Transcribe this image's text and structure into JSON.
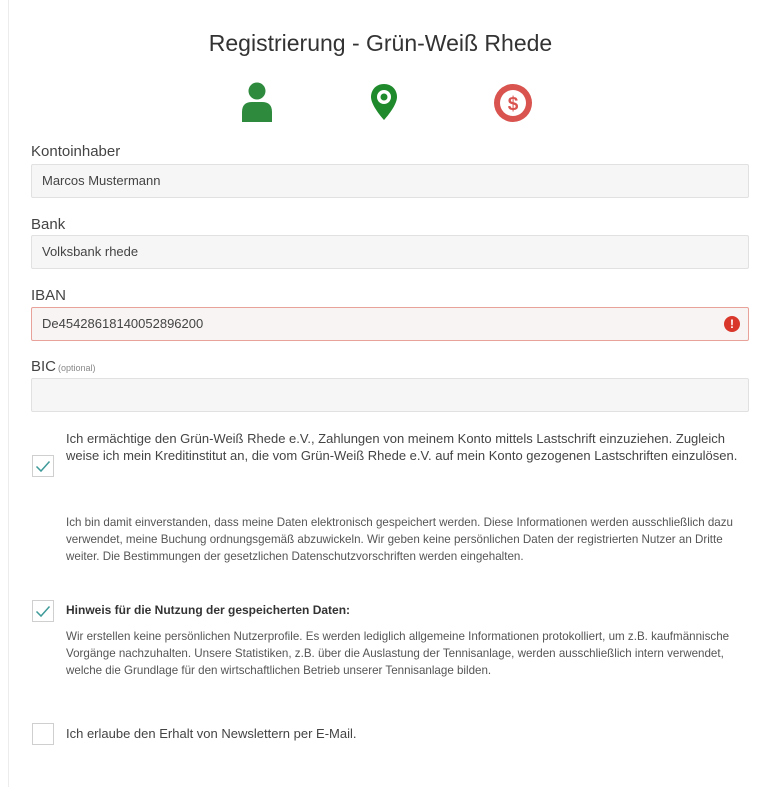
{
  "page": {
    "title": "Registrierung - Grün-Weiß Rhede"
  },
  "steps": [
    {
      "icon": "user-icon",
      "color": "#2e8b3e"
    },
    {
      "icon": "location-pin-icon",
      "color": "#1f8a2c"
    },
    {
      "icon": "dollar-circle-icon",
      "color": "#d9534f"
    }
  ],
  "fields": {
    "account_holder": {
      "label": "Kontoinhaber",
      "value": "Marcos Mustermann"
    },
    "bank": {
      "label": "Bank",
      "value": "Volksbank rhede"
    },
    "iban": {
      "label": "IBAN",
      "value": "De45428618140052896200",
      "error_icon": "!"
    },
    "bic": {
      "label": "BIC",
      "optional": "(optional)",
      "value": ""
    }
  },
  "consents": {
    "sepa": {
      "checked": true,
      "text": "Ich ermächtige den Grün-Weiß Rhede e.V., Zahlungen von meinem Konto mittels Lastschrift einzuziehen. Zugleich weise ich mein Kreditinstitut an, die vom Grün-Weiß Rhede e.V. auf mein Konto gezogenen Lastschriften einzulösen."
    },
    "privacy_text": "Ich bin damit einverstanden, dass meine Daten elektronisch gespeichert werden. Diese Informationen werden ausschließlich dazu verwendet, meine Buchung ordnungsgemäß abzuwickeln. Wir geben keine persönlichen Daten der registrierten Nutzer an Dritte weiter. Die Bestimmungen der gesetzlichen Datenschutzvorschriften werden eingehalten.",
    "data_usage": {
      "checked": true,
      "heading": "Hinweis für die Nutzung der gespeicherten Daten:",
      "text": "Wir erstellen keine persönlichen Nutzerprofile. Es werden lediglich allgemeine Informationen protokolliert, um z.B. kaufmännische Vorgänge nachzuhalten. Unsere Statistiken, z.B. über die Auslastung der Tennisanlage, werden ausschließlich intern verwendet, welche die Grundlage für den wirtschaftlichen Betrieb unserer Tennisanlage bilden."
    },
    "newsletter": {
      "checked": false,
      "text": "Ich erlaube den Erhalt von Newslettern per E-Mail."
    }
  }
}
